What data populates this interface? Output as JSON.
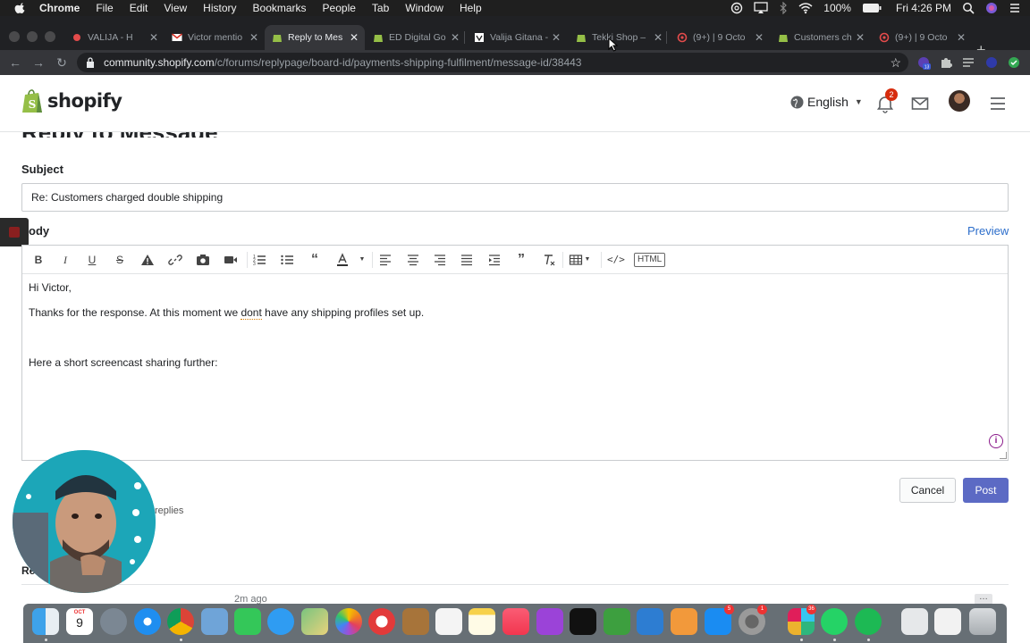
{
  "menubar": {
    "app": "Chrome",
    "items": [
      "File",
      "Edit",
      "View",
      "History",
      "Bookmarks",
      "People",
      "Tab",
      "Window",
      "Help"
    ],
    "battery": "100%",
    "clock": "Fri 4:26 PM"
  },
  "tabs": [
    {
      "label": "VALIJA - H"
    },
    {
      "label": "Victor mentio"
    },
    {
      "label": "Reply to Mes"
    },
    {
      "label": "ED Digital Go"
    },
    {
      "label": "Valija Gitana -"
    },
    {
      "label": "Tekki Shop –"
    },
    {
      "label": "(9+) | 9 Octo"
    },
    {
      "label": "Customers ch"
    },
    {
      "label": "(9+) | 9 Octo"
    }
  ],
  "address": {
    "host": "community.shopify.com",
    "path": "/c/forums/replypage/board-id/payments-shipping-fulfilment/message-id/38443"
  },
  "extensions": {
    "badge": "13"
  },
  "header": {
    "logo": "shopify",
    "language": "English",
    "notifications_count": "2"
  },
  "page": {
    "title_partial": "Reply to Message",
    "subject_label": "Subject",
    "subject_value": "Re: Customers charged double shipping",
    "body_label": "Body",
    "body_label_visible": "ody",
    "preview": "Preview",
    "html_button": "HTML",
    "body": {
      "line1": "Hi Victor,",
      "line2_before": "Thanks for the response. At this moment we ",
      "line2_word": "dont",
      "line2_after": " have any shipping profiles set up.",
      "line3": "Here a short screencast sharing further:"
    },
    "cancel": "Cancel",
    "post": "Post",
    "replies_fragment": "replies",
    "replies_heading_fragment": "Re",
    "time_ago": "2m ago"
  },
  "dock": {
    "calendar_month": "OCT",
    "calendar_day": "9",
    "badges": {
      "settings": "1",
      "appstore": "5",
      "slack": "36"
    }
  },
  "colors": {
    "primary_button": "#5c6ac4",
    "link": "#2c6ecb",
    "shopify_green": "#95bf47",
    "notification_red": "#d72c0d"
  }
}
